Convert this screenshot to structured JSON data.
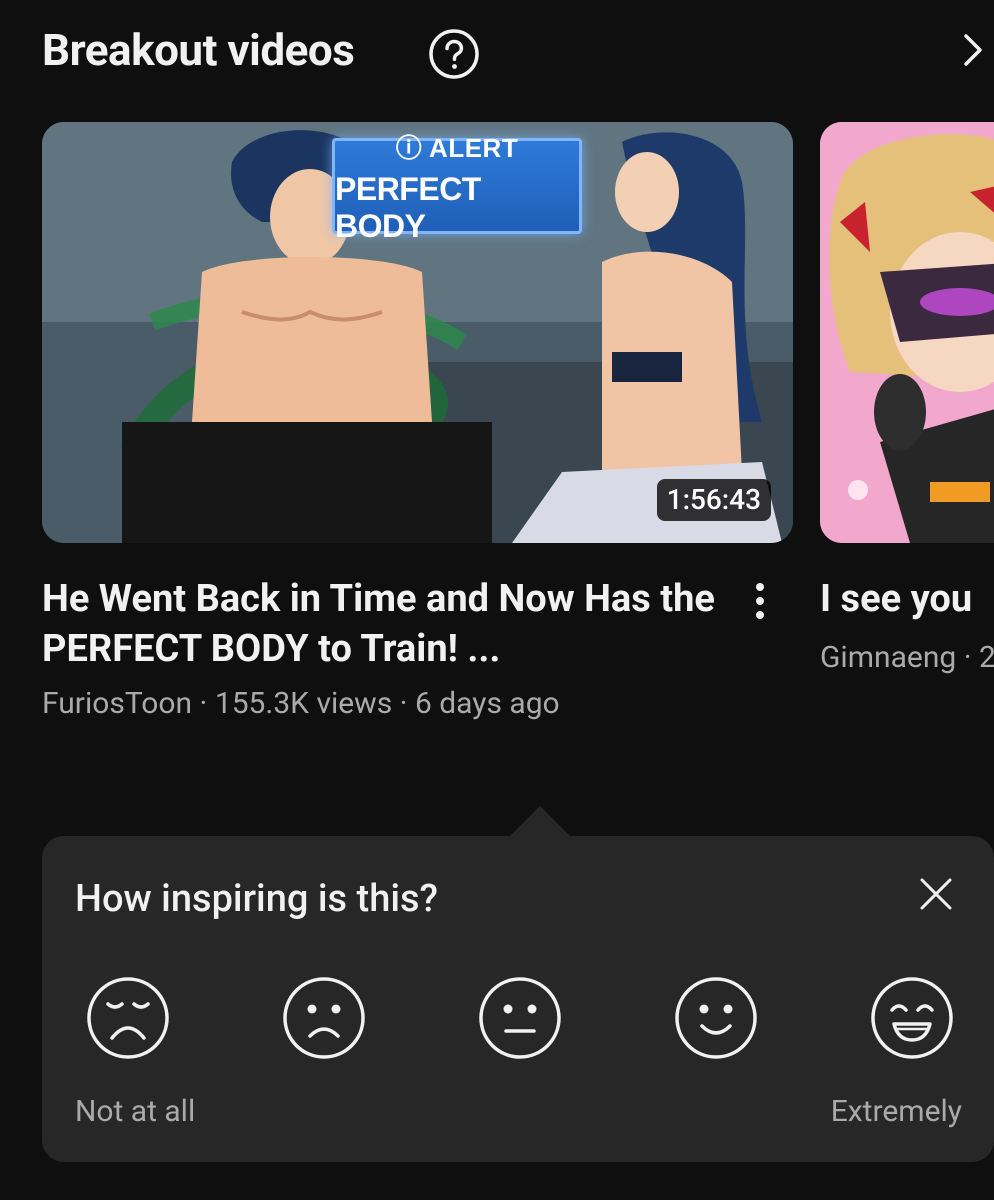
{
  "section": {
    "title": "Breakout videos",
    "help_icon": "help-circle-icon",
    "next_icon": "chevron-right-icon"
  },
  "videos": [
    {
      "title": "He Went Back in Time and Now Has the PERFECT BODY to Train! ...",
      "channel": "FuriosToon",
      "views": "155.3K views",
      "age": "6 days ago",
      "duration": "1:56:43",
      "thumbnail_text": {
        "line1": "ⓘ ALERT",
        "line2": "PERFECT BODY"
      }
    },
    {
      "title": "I see you",
      "channel": "Gimnaeng",
      "meta_suffix": "2"
    }
  ],
  "survey": {
    "question": "How inspiring is this?",
    "close_icon": "close-icon",
    "options": [
      {
        "icon": "very-sad-face-icon"
      },
      {
        "icon": "sad-face-icon"
      },
      {
        "icon": "neutral-face-icon"
      },
      {
        "icon": "smile-face-icon"
      },
      {
        "icon": "grin-face-icon"
      }
    ],
    "label_low": "Not at all",
    "label_high": "Extremely"
  },
  "colors": {
    "background": "#0f0f0f",
    "card": "#272727",
    "text_primary": "#f1f1f1",
    "text_secondary": "#aaaaaa"
  }
}
